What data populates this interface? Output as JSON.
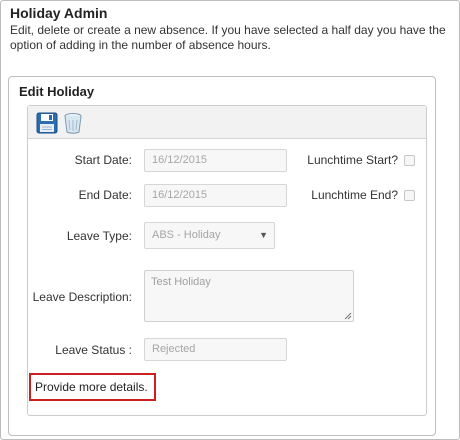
{
  "header": {
    "title": "Holiday Admin",
    "description": "Edit, delete or create a new absence. If you have selected a half day you have the option of adding in the number of absence hours."
  },
  "panel": {
    "title": "Edit Holiday"
  },
  "toolbar": {
    "save_icon": "floppy-disk-icon",
    "delete_icon": "trash-bin-icon"
  },
  "form": {
    "start_date_label": "Start Date:",
    "start_date_value": "16/12/2015",
    "end_date_label": "End Date:",
    "end_date_value": "16/12/2015",
    "lunch_start_label": "Lunchtime Start?",
    "lunch_start_checked": false,
    "lunch_end_label": "Lunchtime End?",
    "lunch_end_checked": false,
    "leave_type_label": "Leave Type:",
    "leave_type_value": "ABS - Holiday",
    "leave_description_label": "Leave Description:",
    "leave_description_value": "Test Holiday",
    "leave_status_label": "Leave Status :",
    "leave_status_value": "Rejected"
  },
  "validation": {
    "message": "Provide more details."
  },
  "colors": {
    "accent_blue": "#2a6db0",
    "error_border": "#cc1f1f",
    "toolbar_bg": "#f2f2f2"
  }
}
